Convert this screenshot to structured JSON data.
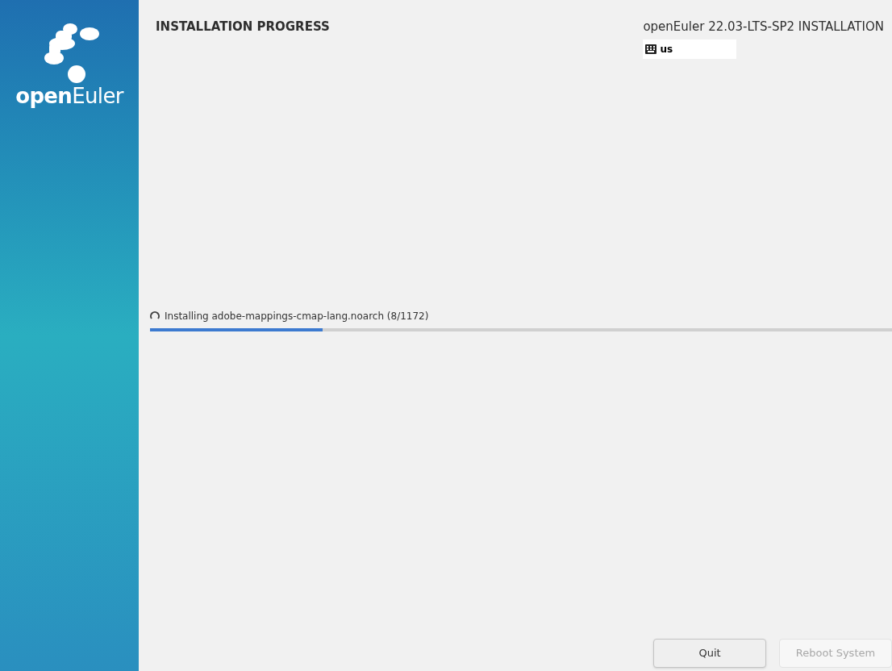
{
  "sidebar": {
    "logo_text_bold": "open",
    "logo_text": "Euler"
  },
  "header": {
    "title": "INSTALLATION PROGRESS",
    "product": "openEuler 22.03-LTS-SP2 INSTALLATION",
    "keyboard_layout": "us"
  },
  "progress": {
    "status": "Installing adobe-mappings-cmap-lang.noarch (8/1172)",
    "level": 0.233
  },
  "buttons": [
    {
      "label": "Quit",
      "disabled": false
    },
    {
      "label": "Reboot System",
      "disabled": true
    }
  ]
}
